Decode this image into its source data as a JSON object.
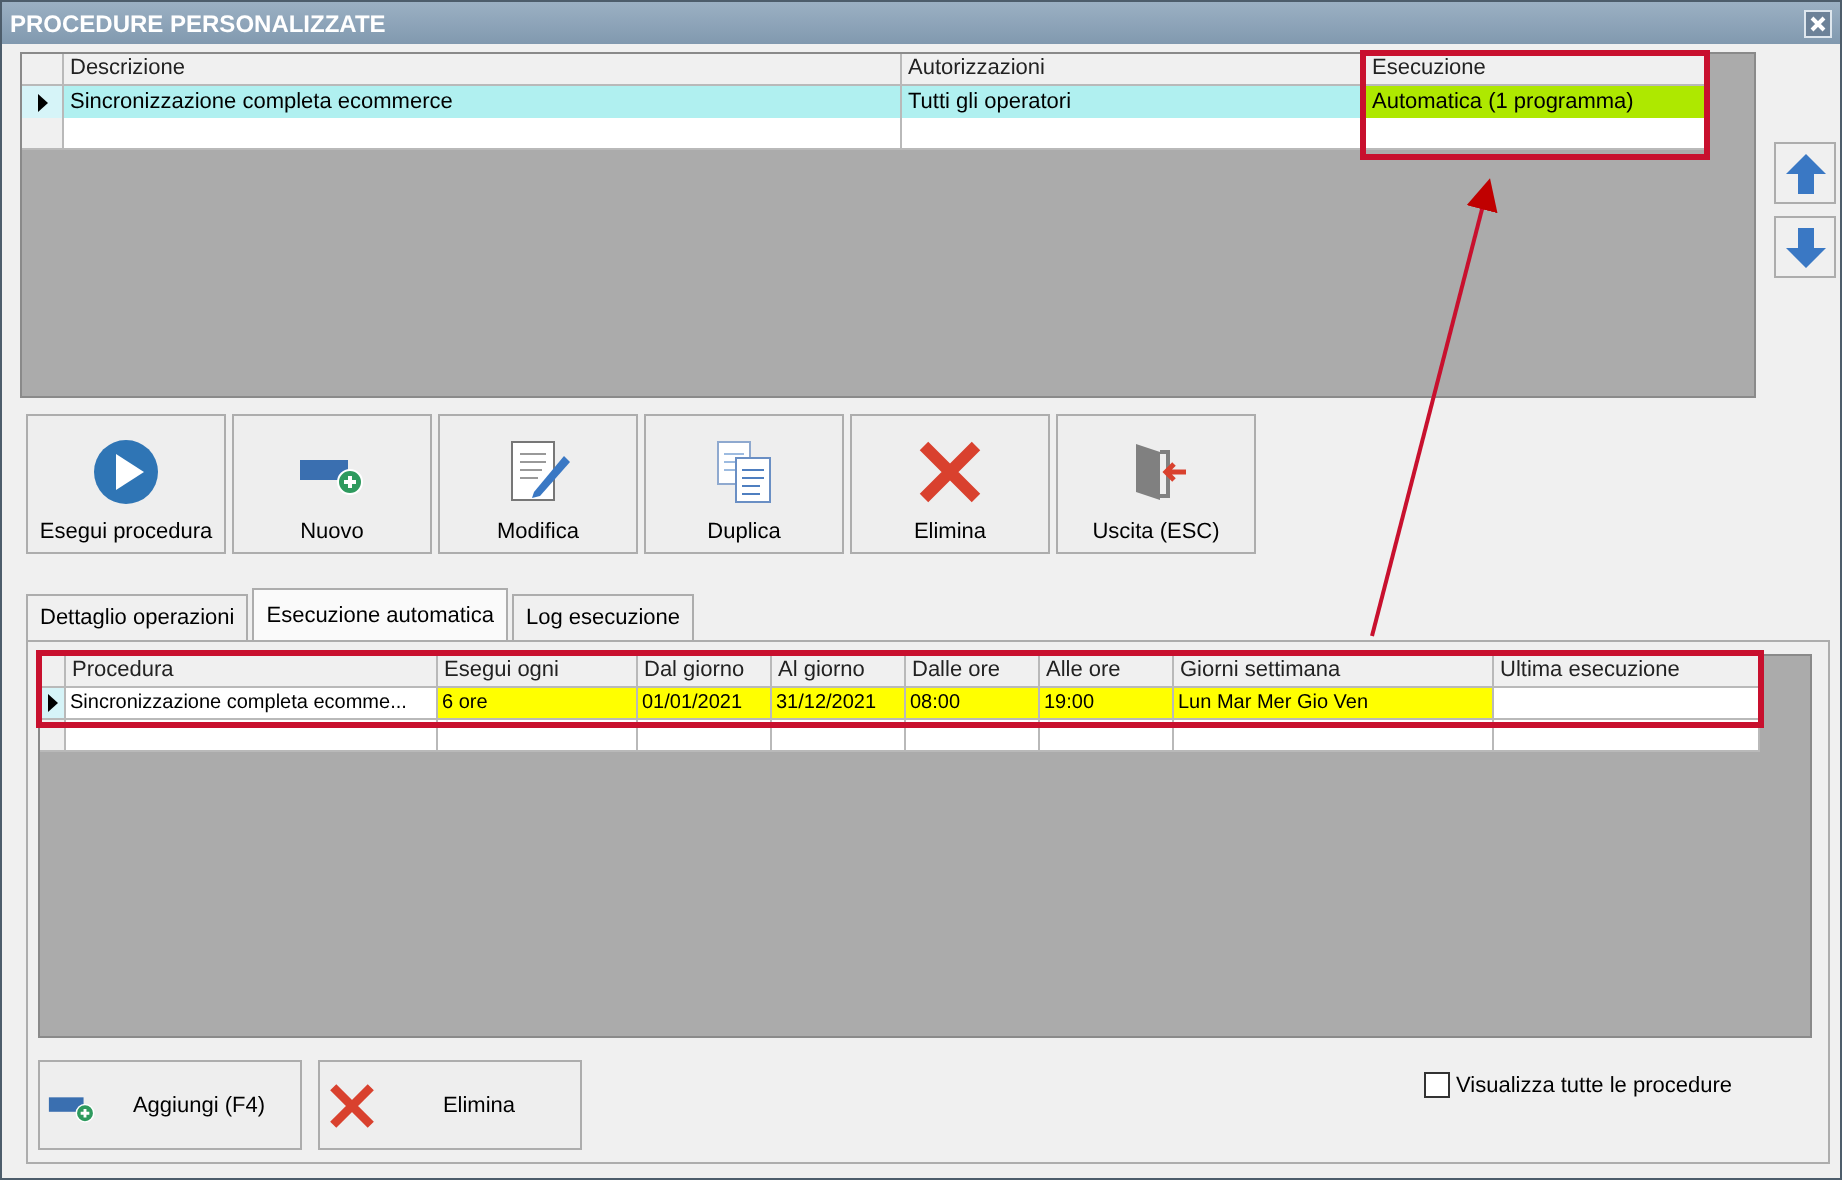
{
  "window": {
    "title": "PROCEDURE PERSONALIZZATE"
  },
  "procedures_table": {
    "columns": [
      "Descrizione",
      "Autorizzazioni",
      "Esecuzione"
    ],
    "rows": [
      {
        "selected": true,
        "cells": [
          {
            "text": "Sincronizzazione completa ecommerce",
            "color": "#b0f0f0"
          },
          {
            "text": "Tutti gli operatori",
            "color": "#b0f0f0"
          },
          {
            "text": "Automatica (1 programma)",
            "color": "#aee800"
          }
        ]
      }
    ]
  },
  "toolbar": [
    {
      "label": "Esegui procedura",
      "kind": "run"
    },
    {
      "label": "Nuovo",
      "kind": "add"
    },
    {
      "label": "Modifica",
      "kind": "edit"
    },
    {
      "label": "Duplica",
      "kind": "copy"
    },
    {
      "label": "Elimina",
      "kind": "delete"
    },
    {
      "label": "Uscita (ESC)",
      "kind": "exit"
    }
  ],
  "tabs": [
    {
      "label": "Dettaglio operazioni",
      "selected": false
    },
    {
      "label": "Esecuzione automatica",
      "selected": true
    },
    {
      "label": "Log esecuzione",
      "selected": false
    }
  ],
  "schedule_table": {
    "columns": [
      "Procedura",
      "Esegui ogni",
      "Dal giorno",
      "Al giorno",
      "Dalle ore",
      "Alle ore",
      "Giorni settimana",
      "Ultima esecuzione"
    ],
    "rows": [
      {
        "selected": true,
        "cells": [
          {
            "text": "Sincronizzazione completa ecomme...",
            "color": "#ffffff"
          },
          {
            "text": "6 ore",
            "color": "#ffff00"
          },
          {
            "text": "01/01/2021",
            "color": "#ffff00"
          },
          {
            "text": "31/12/2021",
            "color": "#ffff00"
          },
          {
            "text": "08:00",
            "color": "#ffff00"
          },
          {
            "text": "19:00",
            "color": "#ffff00"
          },
          {
            "text": "Lun Mar Mer Gio Ven",
            "color": "#ffff00"
          },
          {
            "color": "#ffffff"
          }
        ]
      }
    ]
  },
  "bottom_buttons": [
    {
      "label": "Aggiungi (F4)",
      "kind": "add"
    },
    {
      "label": "Elimina",
      "kind": "delete"
    }
  ],
  "show_all_checkbox": {
    "label": "Visualizza tutte le procedure",
    "checked": false
  }
}
